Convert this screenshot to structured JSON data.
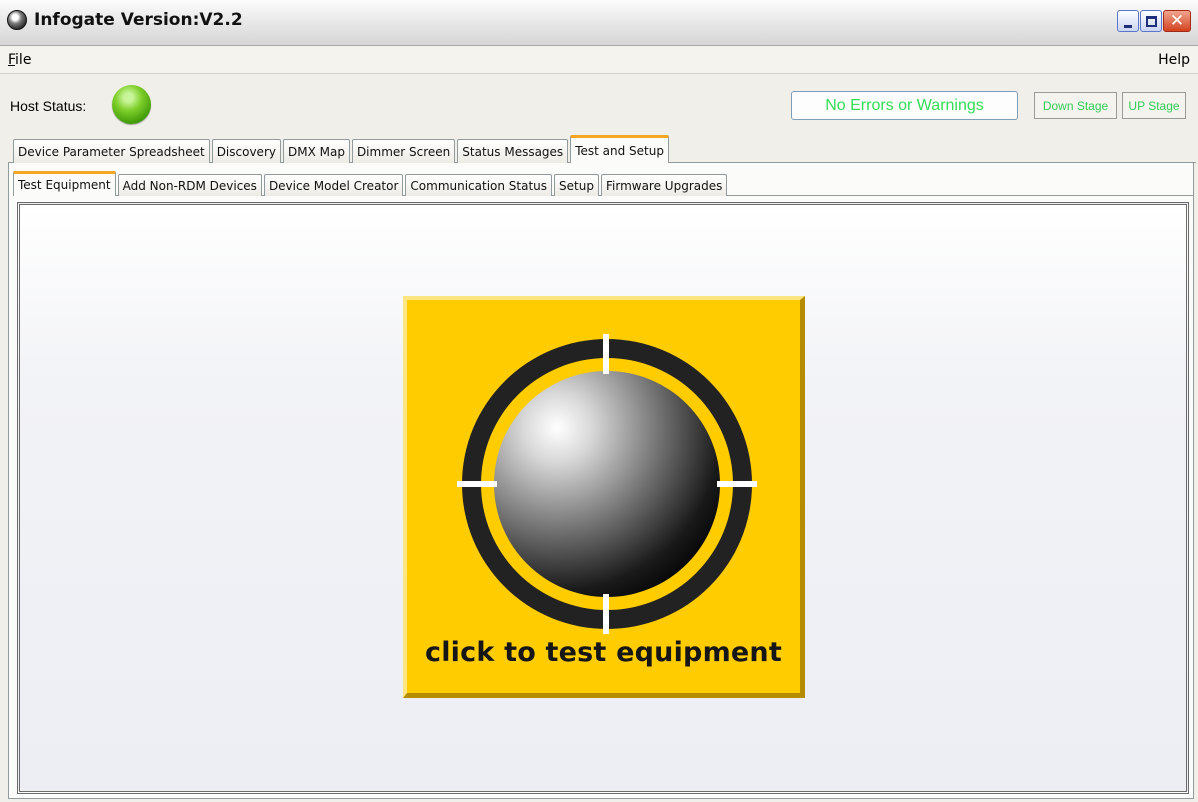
{
  "window": {
    "title": "Infogate Version:V2.2",
    "controls": {
      "minimize_icon": "minimize-icon",
      "maximize_icon": "maximize-icon",
      "close_icon": "close-icon"
    }
  },
  "menu": {
    "file_first": "F",
    "file_rest": "ile",
    "help": "Help"
  },
  "status": {
    "host_label": "Host Status:",
    "host_color": "#5fb81a",
    "message": "No Errors or Warnings",
    "down_stage": "Down Stage",
    "up_stage": "UP Stage"
  },
  "main_tabs": [
    {
      "label": "Device Parameter Spreadsheet"
    },
    {
      "label": "Discovery"
    },
    {
      "label": "DMX Map"
    },
    {
      "label": "Dimmer Screen"
    },
    {
      "label": "Status Messages"
    },
    {
      "label": "Test and Setup",
      "active": true
    }
  ],
  "sub_tabs": [
    {
      "label": "Test Equipment",
      "active": true
    },
    {
      "label": "Add Non-RDM Devices"
    },
    {
      "label": "Device Model Creator"
    },
    {
      "label": "Communication Status"
    },
    {
      "label": "Setup"
    },
    {
      "label": "Firmware Upgrades"
    }
  ],
  "test_button": {
    "caption": "click to test equipment",
    "icon": "crosshair-sphere-icon",
    "color": "#ffcc00"
  },
  "colors": {
    "accent_tab": "#f5a623",
    "status_green": "#33dd55"
  }
}
